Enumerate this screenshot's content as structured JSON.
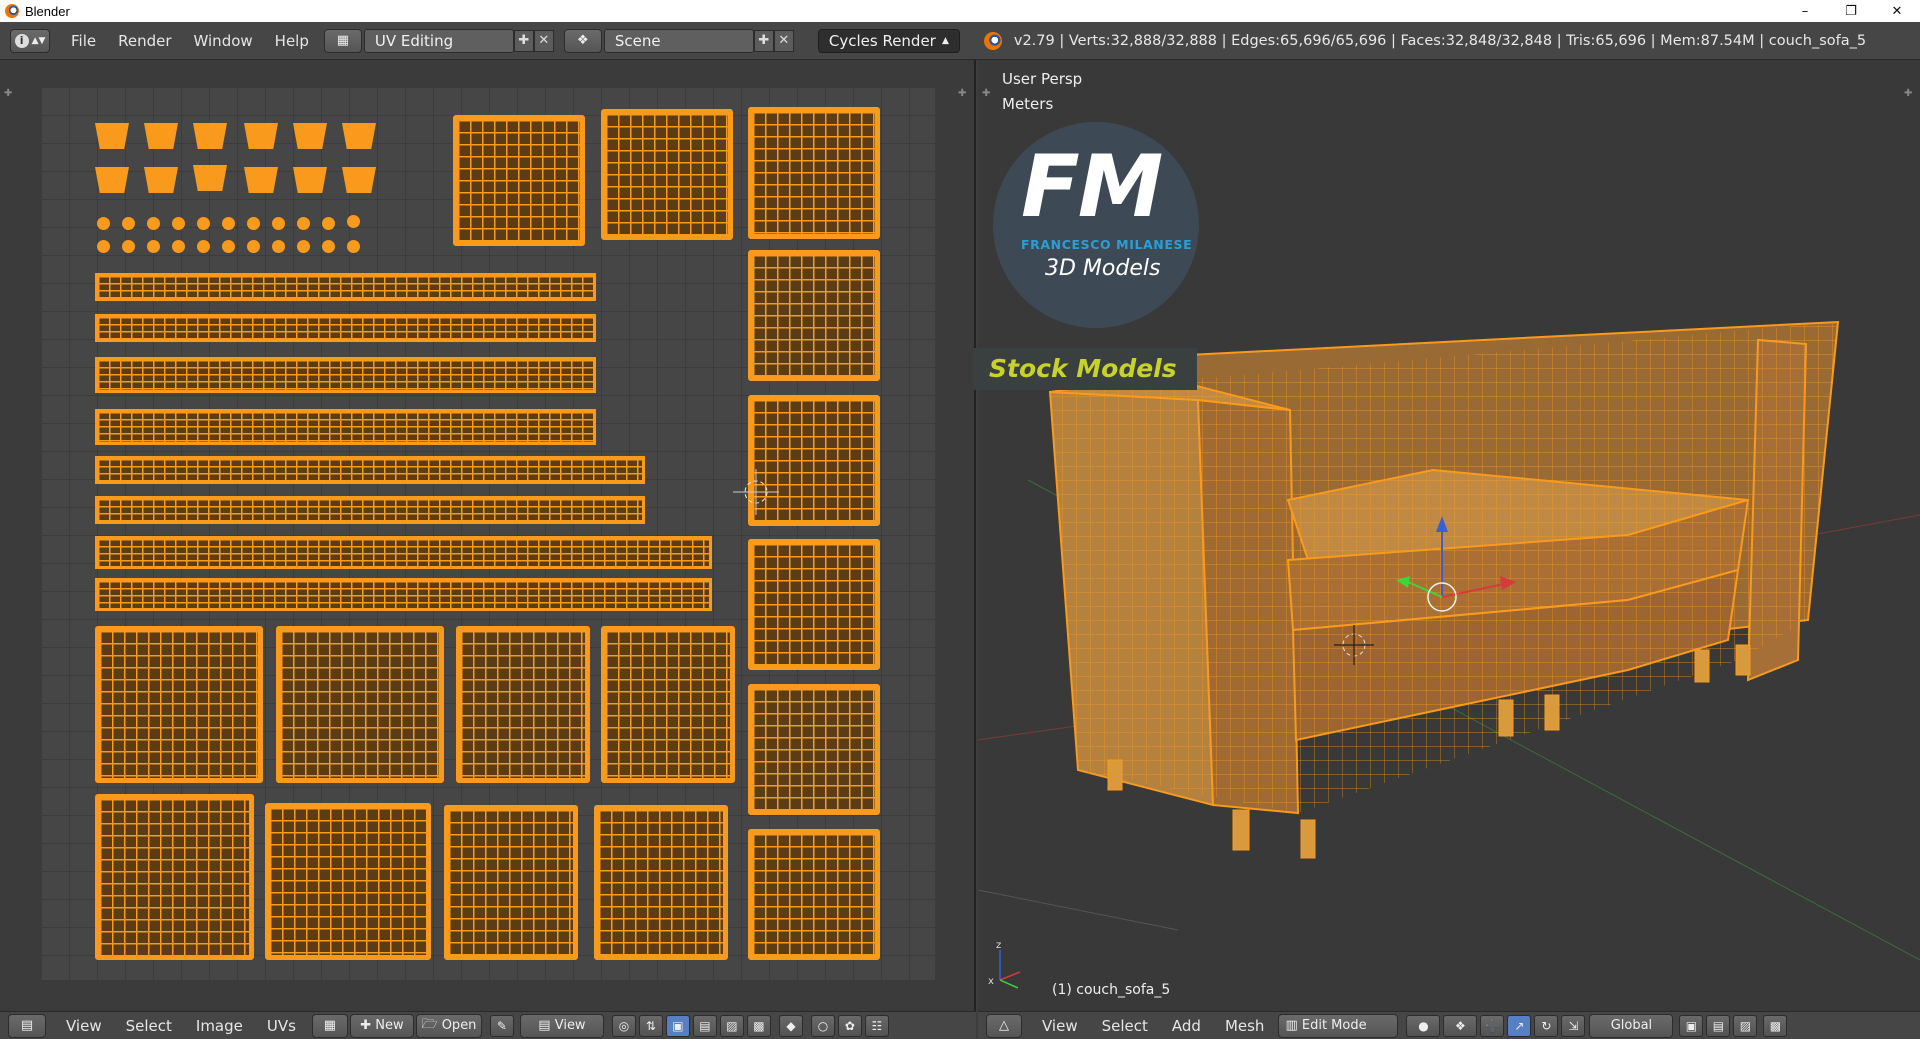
{
  "window": {
    "title": "Blender",
    "minimize_glyph": "–",
    "restore_glyph": "❐",
    "close_glyph": "✕"
  },
  "infobar": {
    "menus": [
      "File",
      "Render",
      "Window",
      "Help"
    ],
    "screen_layout": "UV Editing",
    "scene": "Scene",
    "render_engine": "Cycles Render",
    "stats": "v2.79 | Verts:32,888/32,888 | Edges:65,696/65,696 | Faces:32,848/32,848 | Tris:65,696 | Mem:87.54M | couch_sofa_5"
  },
  "uv_editor": {
    "menus": [
      "View",
      "Select",
      "Image",
      "UVs"
    ],
    "new_label": "New",
    "open_label": "Open",
    "view_label": "View"
  },
  "viewport": {
    "view_name": "User Persp",
    "units": "Meters",
    "object_label": "(1) couch_sofa_5",
    "menus": [
      "View",
      "Select",
      "Add",
      "Mesh"
    ],
    "mode": "Edit Mode",
    "orientation": "Global"
  },
  "watermark": {
    "logo_letters": "FM",
    "author": "FRANCESCO MILANESE",
    "tagline": "3D Models",
    "badge": "Stock Models"
  },
  "icons": {
    "info": "info-icon",
    "layout": "screen-layout-icon",
    "scene": "scene-icon",
    "blender": "blender-logo-icon"
  },
  "colors": {
    "uv_orange": "#f99a1c",
    "header_bg": "#464646",
    "viewport_bg": "#393939",
    "logo_blue": "#2a9fd6",
    "badge_yellow": "#c8d22a"
  }
}
